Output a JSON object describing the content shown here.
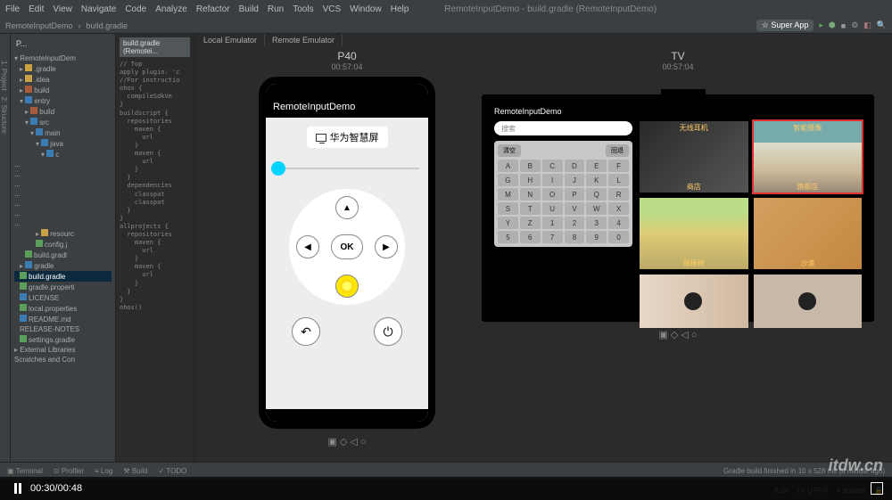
{
  "menu": [
    "File",
    "Edit",
    "View",
    "Navigate",
    "Code",
    "Analyze",
    "Refactor",
    "Build",
    "Run",
    "Tools",
    "VCS",
    "Window",
    "Help"
  ],
  "window_title": "RemoteInputDemo - build.gradle (RemoteInputDemo)",
  "crumb": {
    "project": "RemoteInputDemo",
    "file": "build.gradle"
  },
  "super_btn": "Super App",
  "editor_tabs": {
    "selected": "build.gradle (Remotei...",
    "remote": "Remote Emulator"
  },
  "project_panel": {
    "header": "P...",
    "items": [
      {
        "label": "RemoteInputDem",
        "depth": 0,
        "open": true,
        "cls": "folder open"
      },
      {
        "label": ".gradle",
        "depth": 1,
        "cls": "folder",
        "ico": "y"
      },
      {
        "label": ".idea",
        "depth": 1,
        "cls": "folder",
        "ico": "y"
      },
      {
        "label": "build",
        "depth": 1,
        "cls": "folder",
        "ico": "r"
      },
      {
        "label": "entry",
        "depth": 1,
        "cls": "folder open",
        "ico": "b"
      },
      {
        "label": "build",
        "depth": 2,
        "cls": "folder",
        "ico": "r"
      },
      {
        "label": "src",
        "depth": 2,
        "cls": "folder open",
        "ico": "b"
      },
      {
        "label": "main",
        "depth": 3,
        "cls": "folder open",
        "ico": "b"
      },
      {
        "label": "java",
        "depth": 4,
        "cls": "folder open",
        "ico": "b"
      },
      {
        "label": "c",
        "depth": 5,
        "cls": "folder open",
        "ico": "b"
      },
      {
        "label": "...",
        "depth": 6,
        "cls": ""
      },
      {
        "label": "...",
        "depth": 6,
        "cls": ""
      },
      {
        "label": "...",
        "depth": 6,
        "cls": ""
      },
      {
        "label": "...",
        "depth": 6,
        "cls": ""
      },
      {
        "label": "...",
        "depth": 6,
        "cls": ""
      },
      {
        "label": "...",
        "depth": 6,
        "cls": ""
      },
      {
        "label": "...",
        "depth": 6,
        "cls": ""
      },
      {
        "label": "resourc",
        "depth": 4,
        "cls": "folder",
        "ico": "y"
      },
      {
        "label": "config.j",
        "depth": 4,
        "cls": "",
        "ico": "g"
      },
      {
        "label": "build.gradl",
        "depth": 2,
        "cls": "",
        "ico": "g"
      },
      {
        "label": "gradle",
        "depth": 1,
        "cls": "folder",
        "ico": "b"
      },
      {
        "label": "build.gradle",
        "depth": 1,
        "cls": "sel",
        "ico": "g"
      },
      {
        "label": "gradle.properti",
        "depth": 1,
        "cls": "",
        "ico": "g"
      },
      {
        "label": "LICENSE",
        "depth": 1,
        "cls": "",
        "ico": "b"
      },
      {
        "label": "local.properties",
        "depth": 1,
        "cls": "",
        "ico": "g"
      },
      {
        "label": "README.md",
        "depth": 1,
        "cls": "",
        "ico": "b"
      },
      {
        "label": "RELEASE-NOTES",
        "depth": 1,
        "cls": ""
      },
      {
        "label": "settings.gradle",
        "depth": 1,
        "cls": "",
        "ico": "g"
      },
      {
        "label": "External Libraries",
        "depth": 0,
        "cls": "folder"
      },
      {
        "label": "Scratches and Con",
        "depth": 0,
        "cls": ""
      }
    ]
  },
  "code_lines": [
    "// Top",
    "apply plugin: 'c",
    "",
    "//For instructio",
    "ohos {",
    "  compileSdkVe",
    "}",
    "",
    "buildscript {",
    "  repositories",
    "    maven {",
    "      url",
    "    }",
    "    maven {",
    "      url",
    "    }",
    "  }",
    "  dependencies",
    "    classpat",
    "    classpat",
    "  }",
    "}",
    "",
    "allprojects {",
    "  repositories",
    "    maven {",
    "      url",
    "    }",
    "    maven {",
    "      url",
    "    }",
    "  }",
    "}",
    "",
    "",
    "",
    "",
    "",
    "",
    "",
    "",
    "ohos()"
  ],
  "emulator": {
    "tab1": "Local Emulator",
    "tab2": "Remote Emulator",
    "p40": {
      "title": "P40",
      "time": "00:57:04",
      "app_title": "RemoteInputDemo",
      "device_label": "华为智慧屏",
      "ok": "OK"
    },
    "tv": {
      "title": "TV",
      "time": "00:57:04",
      "app_title": "RemoteInputDemo",
      "search_placeholder": "搜索",
      "kb_top": [
        "清空",
        "回退"
      ],
      "keys": [
        "A",
        "B",
        "C",
        "D",
        "E",
        "F",
        "G",
        "H",
        "I",
        "J",
        "K",
        "L",
        "M",
        "N",
        "O",
        "P",
        "Q",
        "R",
        "S",
        "T",
        "U",
        "V",
        "W",
        "X",
        "Y",
        "Z",
        "1",
        "2",
        "3",
        "4",
        "5",
        "6",
        "7",
        "8",
        "9",
        "0"
      ],
      "cards": [
        {
          "toplabel": "无线耳机",
          "label": "商店",
          "img": "img1"
        },
        {
          "toplabel": "智能摄像",
          "label": "旗舰店",
          "img": "img2",
          "sel": true
        },
        {
          "label": "胡杨树",
          "img": "img3"
        },
        {
          "label": "沙漠",
          "img": "img4"
        },
        {
          "label": "",
          "img": "img5"
        },
        {
          "label": "",
          "img": "img6"
        }
      ]
    },
    "ctrls": "▣ ◇ ◁ ○"
  },
  "footer_tabs": [
    "Terminal",
    "Profiler",
    "Log",
    "Build",
    "TODO"
  ],
  "footer_msg": "Gradle build finished in 10 s 528 ms (a minute ago)",
  "statusbar": {
    "pos": "8:24",
    "enc": "LF UTF-8",
    "spaces": "4 spaces"
  },
  "video": {
    "time": "00:30/00:48"
  },
  "watermark": "itdw.cn"
}
